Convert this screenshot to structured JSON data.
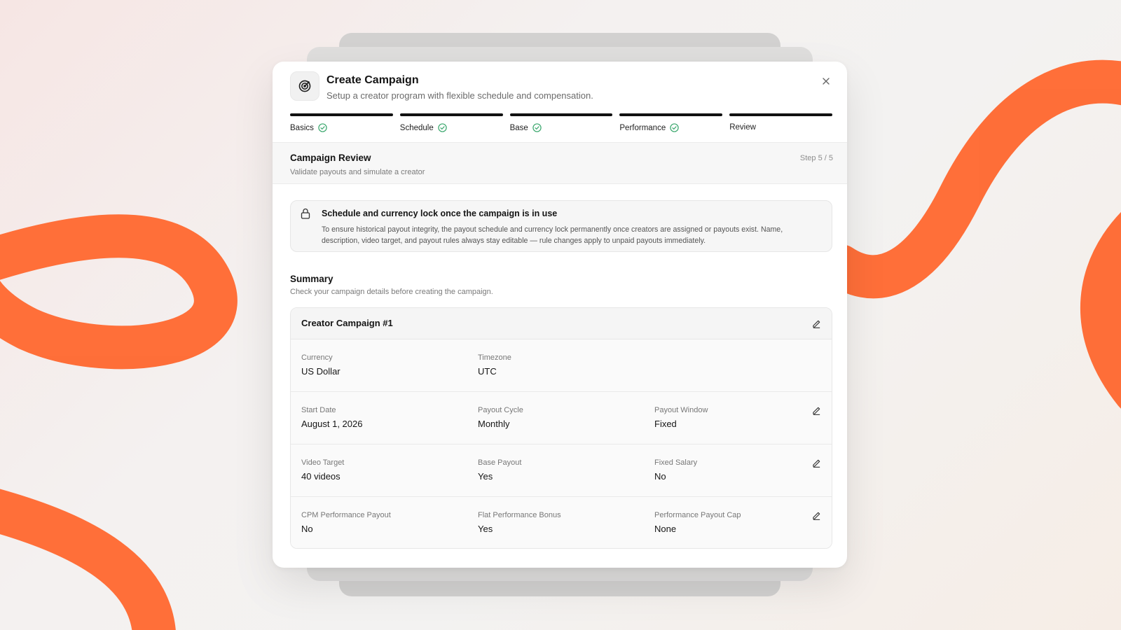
{
  "header": {
    "title": "Create Campaign",
    "subtitle": "Setup a creator program with flexible schedule and compensation."
  },
  "steps": [
    {
      "label": "Basics",
      "done": true
    },
    {
      "label": "Schedule",
      "done": true
    },
    {
      "label": "Base",
      "done": true
    },
    {
      "label": "Performance",
      "done": true
    },
    {
      "label": "Review",
      "done": false
    }
  ],
  "section": {
    "title": "Campaign Review",
    "subtitle": "Validate payouts and simulate a creator",
    "step_indicator": "Step 5 / 5"
  },
  "notice": {
    "title": "Schedule and currency lock once the campaign is in use",
    "body": "To ensure historical payout integrity, the payout schedule and currency lock permanently once creators are assigned or payouts exist. Name, description, video target, and payout rules always stay editable — rule changes apply to unpaid payouts immediately."
  },
  "summary": {
    "title": "Summary",
    "subtitle": "Check your campaign details before creating the campaign.",
    "campaign_name": "Creator Campaign #1",
    "rows": [
      {
        "fields": [
          {
            "label": "Currency",
            "value": "US Dollar"
          },
          {
            "label": "Timezone",
            "value": "UTC"
          }
        ],
        "editable": false
      },
      {
        "fields": [
          {
            "label": "Start Date",
            "value": "August 1, 2026"
          },
          {
            "label": "Payout Cycle",
            "value": "Monthly"
          },
          {
            "label": "Payout Window",
            "value": "Fixed"
          }
        ],
        "editable": true
      },
      {
        "fields": [
          {
            "label": "Video Target",
            "value": "40 videos"
          },
          {
            "label": "Base Payout",
            "value": "Yes"
          },
          {
            "label": "Fixed Salary",
            "value": "No"
          }
        ],
        "editable": true
      },
      {
        "fields": [
          {
            "label": "CPM Performance Payout",
            "value": "No"
          },
          {
            "label": "Flat Performance Bonus",
            "value": "Yes"
          },
          {
            "label": "Performance Payout Cap",
            "value": "None"
          }
        ],
        "editable": true
      }
    ]
  },
  "colors": {
    "accent": "#ff6a33",
    "check": "#3aa76d",
    "progress_bar": "#111111"
  },
  "icons": {
    "header": "target-icon",
    "close": "close-icon",
    "step_done": "check-circle-icon",
    "notice": "lock-icon",
    "edit": "pencil-icon"
  }
}
